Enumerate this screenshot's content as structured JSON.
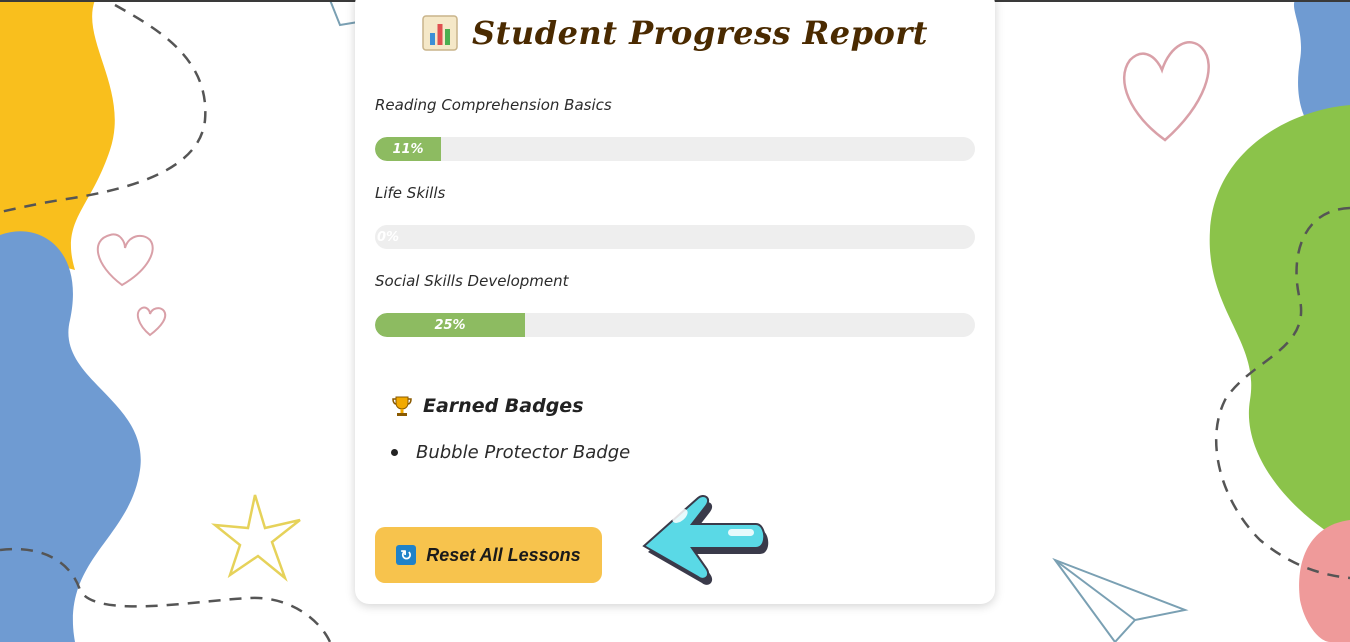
{
  "report": {
    "title": "Student Progress Report",
    "title_icon": "bar-chart-icon"
  },
  "lessons": [
    {
      "label": "Reading Comprehension Basics",
      "progress_percent": 11,
      "progress_text": "11%"
    },
    {
      "label": "Life Skills",
      "progress_percent": 0,
      "progress_text": "0%"
    },
    {
      "label": "Social Skills Development",
      "progress_percent": 25,
      "progress_text": "25%"
    }
  ],
  "badges": {
    "title": "Earned Badges",
    "icon": "trophy-icon",
    "items": [
      "Bubble Protector Badge"
    ]
  },
  "actions": {
    "reset_label": "Reset All Lessons",
    "reset_icon": "refresh-icon"
  },
  "colors": {
    "progress_fill": "#8dbb61",
    "track": "#eeeeee",
    "reset_button": "#f7c34d",
    "title": "#4a2a00",
    "blob_yellow": "#f9bf1d",
    "blob_blue": "#6f9bd2",
    "blob_green": "#8bc34a",
    "blob_pink": "#ef9a9a",
    "arrow": "#5ad9e6"
  }
}
